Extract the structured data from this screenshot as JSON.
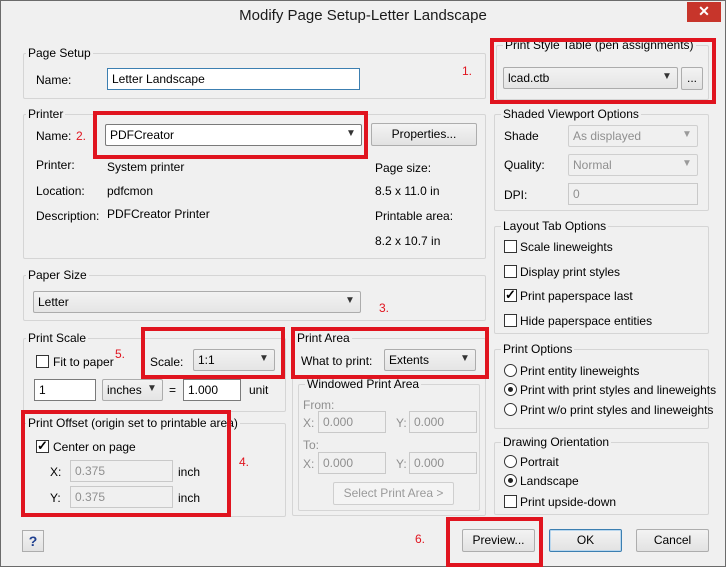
{
  "window": {
    "title": "Modify Page Setup-Letter Landscape",
    "close_symbol": "✕"
  },
  "page_setup": {
    "title": "Page Setup",
    "name_label": "Name:",
    "name_value": "Letter Landscape"
  },
  "printer": {
    "title": "Printer",
    "name_label": "Name:",
    "name_value": "PDFCreator",
    "properties_button": "Properties...",
    "printer_label": "Printer:",
    "printer_value": "System printer",
    "location_label": "Location:",
    "location_value": "pdfcmon",
    "description_label": "Description:",
    "description_value": "PDFCreator Printer",
    "page_size_label": "Page size:",
    "page_size_value": "8.5 x 11.0 in",
    "printable_area_label": "Printable area:",
    "printable_area_value": "8.2 x 10.7 in"
  },
  "paper_size": {
    "title": "Paper Size",
    "value": "Letter"
  },
  "print_scale": {
    "title": "Print Scale",
    "fit_to_paper_label": "Fit to paper",
    "fit_to_paper_checked": false,
    "scale_label": "Scale:",
    "scale_value": "1:1",
    "inches_value": "1",
    "units_value": "inches",
    "equals": "=",
    "unit_value": "1.000",
    "unit_label": "unit"
  },
  "print_area": {
    "title": "Print Area",
    "what_to_print_label": "What to print:",
    "what_to_print_value": "Extents",
    "windowed_title": "Windowed Print Area",
    "from_label": "From:",
    "to_label": "To:",
    "x_label": "X:",
    "y_label": "Y:",
    "from_x": "0.000",
    "from_y": "0.000",
    "to_x": "0.000",
    "to_y": "0.000",
    "select_button": "Select Print Area >"
  },
  "print_offset": {
    "title": "Print Offset (origin set to printable area)",
    "center_label": "Center on page",
    "center_checked": true,
    "x_label": "X:",
    "x_value": "0.375",
    "x_unit": "inch",
    "y_label": "Y:",
    "y_value": "0.375",
    "y_unit": "inch"
  },
  "print_style_table": {
    "title": "Print Style Table (pen assignments)",
    "value": "lcad.ctb",
    "browse_button": "..."
  },
  "shaded_viewport": {
    "title": "Shaded Viewport Options",
    "shade_label": "Shade",
    "shade_value": "As displayed",
    "quality_label": "Quality:",
    "quality_value": "Normal",
    "dpi_label": "DPI:",
    "dpi_value": "0"
  },
  "layout_tab": {
    "title": "Layout Tab Options",
    "options": [
      {
        "label": "Scale lineweights",
        "checked": false
      },
      {
        "label": "Display print styles",
        "checked": false
      },
      {
        "label": "Print paperspace last",
        "checked": true
      },
      {
        "label": "Hide paperspace entities",
        "checked": false
      }
    ]
  },
  "print_options": {
    "title": "Print Options",
    "options": [
      {
        "label": "Print entity lineweights",
        "selected": false
      },
      {
        "label": "Print with print styles and lineweights",
        "selected": true
      },
      {
        "label": "Print w/o print styles and lineweights",
        "selected": false
      }
    ]
  },
  "drawing_orientation": {
    "title": "Drawing Orientation",
    "portrait_label": "Portrait",
    "landscape_label": "Landscape",
    "upside_down_label": "Print upside-down",
    "selected": "Landscape"
  },
  "footer": {
    "help": "?",
    "preview_button": "Preview...",
    "ok_button": "OK",
    "cancel_button": "Cancel"
  },
  "annotations": {
    "n1": "1.",
    "n2": "2.",
    "n3": "3.",
    "n4": "4.",
    "n5": "5.",
    "n6": "6.",
    "color": "#e0141f"
  },
  "icons": {
    "dropdown": "chevron-down-icon",
    "check": "check-icon",
    "help": "help-icon",
    "close": "close-icon"
  }
}
